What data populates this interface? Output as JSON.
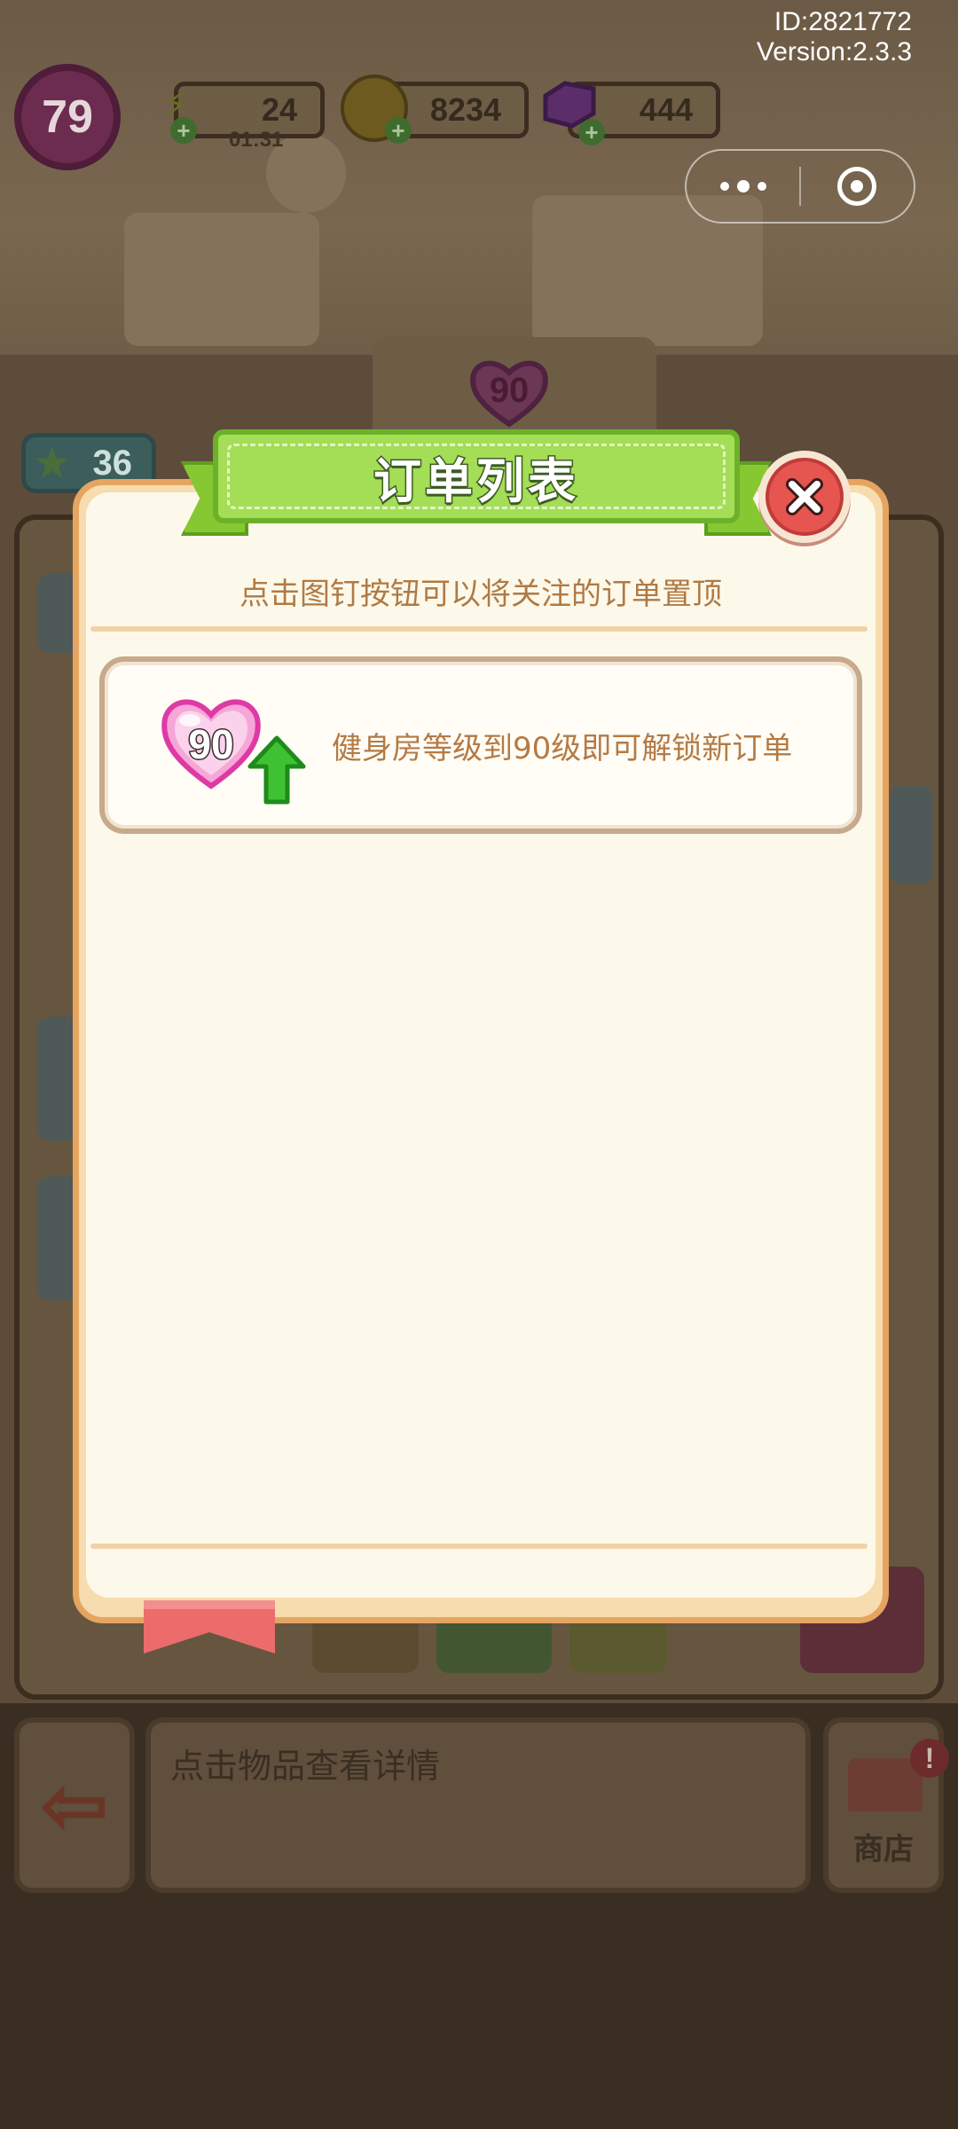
{
  "status_overlay": {
    "id_text": "ID:2821772",
    "version_text": "Version:2.3.3"
  },
  "hud": {
    "player_level": "79",
    "energy": "24",
    "energy_timer": "01:31",
    "coins": "8234",
    "gems": "444"
  },
  "scene": {
    "gym_level_badge": "90",
    "star_count": "36",
    "item_detail_placeholder": "点击物品查看详情",
    "shop_label": "商店",
    "alert_mark": "!"
  },
  "modal": {
    "title": "订单列表",
    "hint": "点击图钉按钮可以将关注的订单置顶",
    "order": {
      "level": "90",
      "text": "健身房等级到90级即可解锁新订单"
    }
  },
  "colors": {
    "ribbon_green": "#a4dd56",
    "close_red": "#e6554f",
    "panel_cream": "#fdf9ea",
    "text_brown": "#b07a45",
    "heart_pink": "#f07cc0"
  }
}
